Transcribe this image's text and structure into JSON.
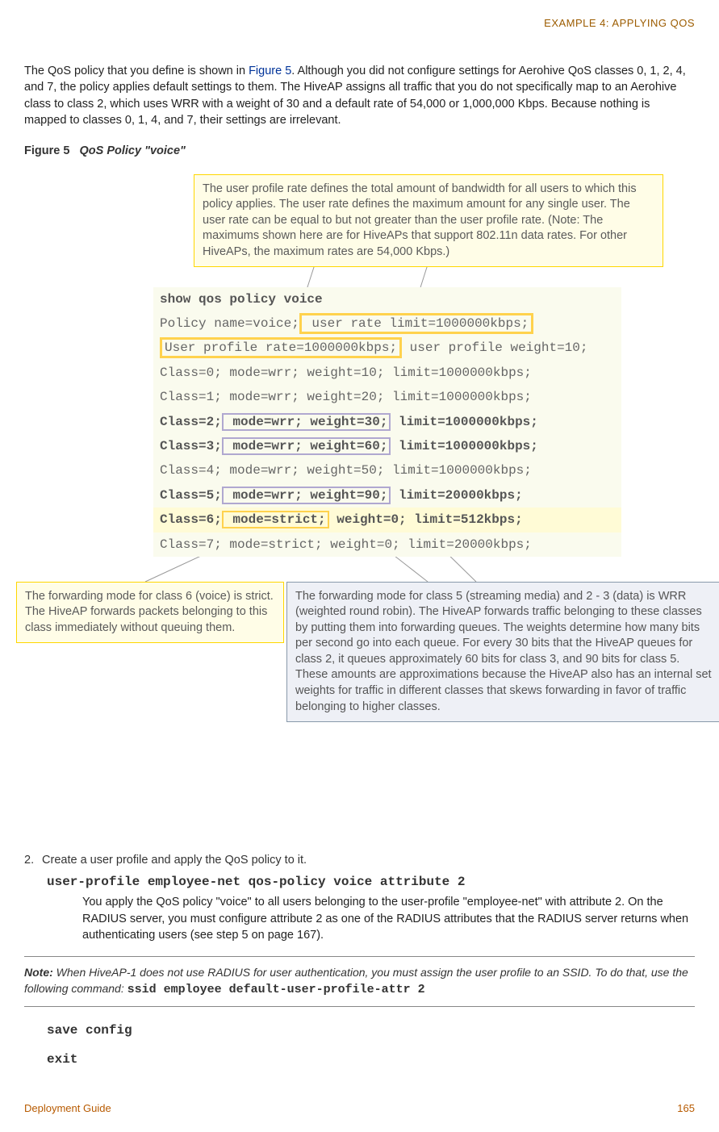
{
  "header": {
    "section": "EXAMPLE 4: APPLYING QOS"
  },
  "para1_a": "The QoS policy that you define is shown in ",
  "para1_link": "Figure 5",
  "para1_b": ". Although you did not configure settings for Aerohive QoS classes 0, 1, 2, 4, and 7, the policy applies default settings to them. The HiveAP assigns all traffic that you do not specifically map to an Aerohive class to class 2, which uses WRR with a weight of 30 and a default rate of 54,000 or 1,000,000 Kbps. Because nothing is mapped to classes 0, 1, 4, and 7, their settings are irrelevant.",
  "figcap_label": "Figure 5",
  "figcap_text": "QoS Policy \"voice\"",
  "callout_top": "The user profile rate defines the total amount of bandwidth for all users to which this policy applies. The user rate defines the maximum amount for any single user. The user rate can be equal to but not greater than the user profile rate. (Note: The maximums shown here are for HiveAPs that support 802.11n data rates. For other HiveAPs, the maximum rates are 54,000 Kbps.)",
  "cli": {
    "cmd": "show qos policy voice",
    "policy_a": "Policy name=voice;",
    "user_rate": " user rate limit=1000000kbps;",
    "profile_rate": "User profile rate=1000000kbps;",
    "profile_weight": " user profile weight=10;",
    "c0": "Class=0; mode=wrr; weight=10; limit=1000000kbps;",
    "c1": "Class=1; mode=wrr; weight=20; limit=1000000kbps;",
    "c2_a": "Class=2;",
    "c2_mid": " mode=wrr; weight=30;",
    "c2_b": " limit=1000000kbps;",
    "c3_a": "Class=3;",
    "c3_mid": " mode=wrr; weight=60;",
    "c3_b": " limit=1000000kbps;",
    "c4": "Class=4; mode=wrr; weight=50; limit=1000000kbps;",
    "c5_a": "Class=5;",
    "c5_mid": " mode=wrr; weight=90;",
    "c5_b": " limit=20000kbps;",
    "c6_a": "Class=6;",
    "c6_mid": " mode=strict;",
    "c6_b": " weight=0; limit=512kbps;",
    "c7": "Class=7; mode=strict; weight=0; limit=20000kbps;"
  },
  "callout_left": "The forwarding mode for class 6 (voice) is strict. The HiveAP forwards packets belonging to this class immediately without queuing them.",
  "callout_right": "The forwarding mode for class 5 (streaming media) and 2 - 3 (data) is WRR (weighted round robin). The HiveAP forwards traffic belonging to these classes by putting them into forwarding queues. The weights determine how many bits per second go into each queue. For every 30 bits that the HiveAP queues for class 2, it queues approximately 60 bits for class 3, and 90 bits for class 5. These amounts are approximations because the HiveAP also has an internal set weights for traffic in different classes that skews forwarding in favor of traffic belonging to higher classes.",
  "step2_num": "2.",
  "step2_text": "Create a user profile and apply the QoS policy to it.",
  "step2_cmd": "user-profile employee-net qos-policy voice attribute 2",
  "step2_desc": "You apply the QoS policy \"voice\" to all users belonging to the user-profile \"employee-net\" with attribute 2. On the RADIUS server, you must configure attribute 2 as one of the RADIUS attributes that the RADIUS server returns when authenticating users (see step 5 on page 167).",
  "note_label": "Note:",
  "note_text": " When HiveAP-1 does not use RADIUS for user authentication, you must assign the user profile to an SSID. To do that, use the following command: ",
  "note_cmd": "ssid employee default-user-profile-attr 2",
  "save_cmd": "save config",
  "exit_cmd": "exit",
  "footer_left": "Deployment Guide",
  "footer_right": "165"
}
